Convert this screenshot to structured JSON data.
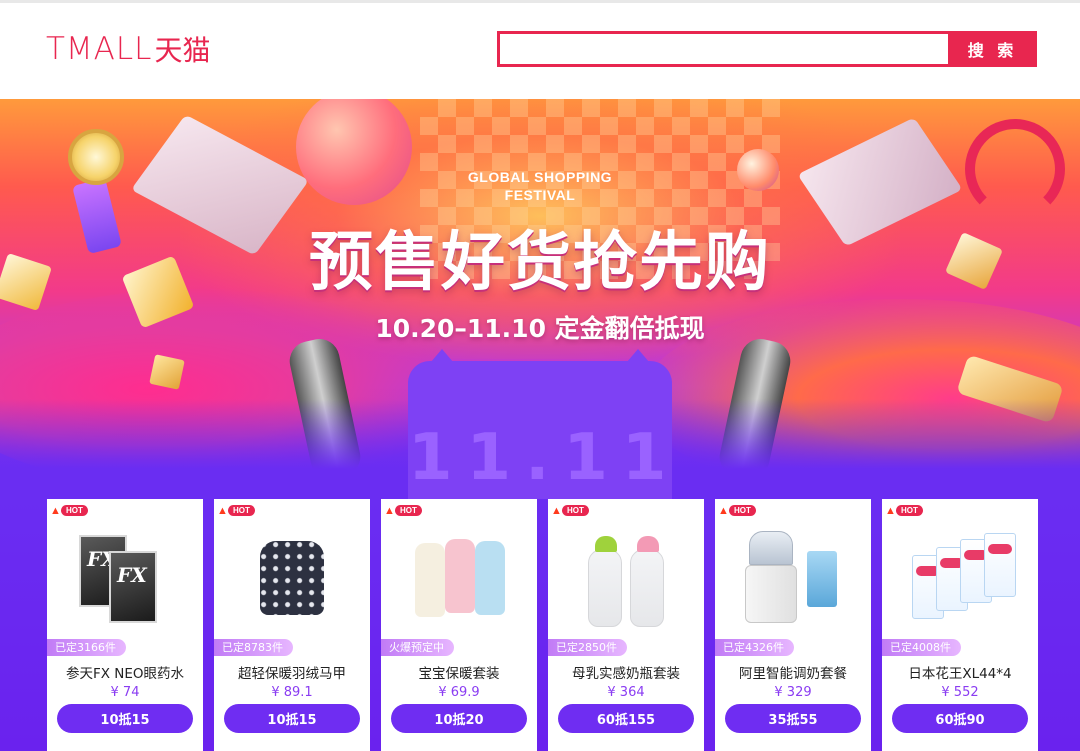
{
  "header": {
    "logo_latin": "TMALL",
    "logo_cn": "天猫",
    "search_value": "",
    "search_button": "搜 索"
  },
  "banner": {
    "subtitle_line1": "GLOBAL SHOPPING",
    "subtitle_line2": "FESTIVAL",
    "title": "预售好货抢先购",
    "date_line": "10.20–11.10 定金翻倍抵现",
    "cat_text": "11.11"
  },
  "products": [
    {
      "hot": "HOT",
      "sold": "已定3166件",
      "name": "参天FX NEO眼药水",
      "price": "¥ 74",
      "coupon": "10抵15"
    },
    {
      "hot": "HOT",
      "sold": "已定8783件",
      "name": "超轻保暖羽绒马甲",
      "price": "¥ 89.1",
      "coupon": "10抵15"
    },
    {
      "hot": "HOT",
      "sold": "火爆预定中",
      "name": "宝宝保暖套装",
      "price": "¥ 69.9",
      "coupon": "10抵20"
    },
    {
      "hot": "HOT",
      "sold": "已定2850件",
      "name": "母乳实感奶瓶套装",
      "price": "¥ 364",
      "coupon": "60抵155"
    },
    {
      "hot": "HOT",
      "sold": "已定4326件",
      "name": "阿里智能调奶套餐",
      "price": "¥ 329",
      "coupon": "35抵55"
    },
    {
      "hot": "HOT",
      "sold": "已定4008件",
      "name": "日本花王XL44*4",
      "price": "¥ 552",
      "coupon": "60抵90"
    }
  ],
  "colors": {
    "brand": "#e8264f",
    "purple": "#6f2df2",
    "price": "#8a3cf2"
  }
}
